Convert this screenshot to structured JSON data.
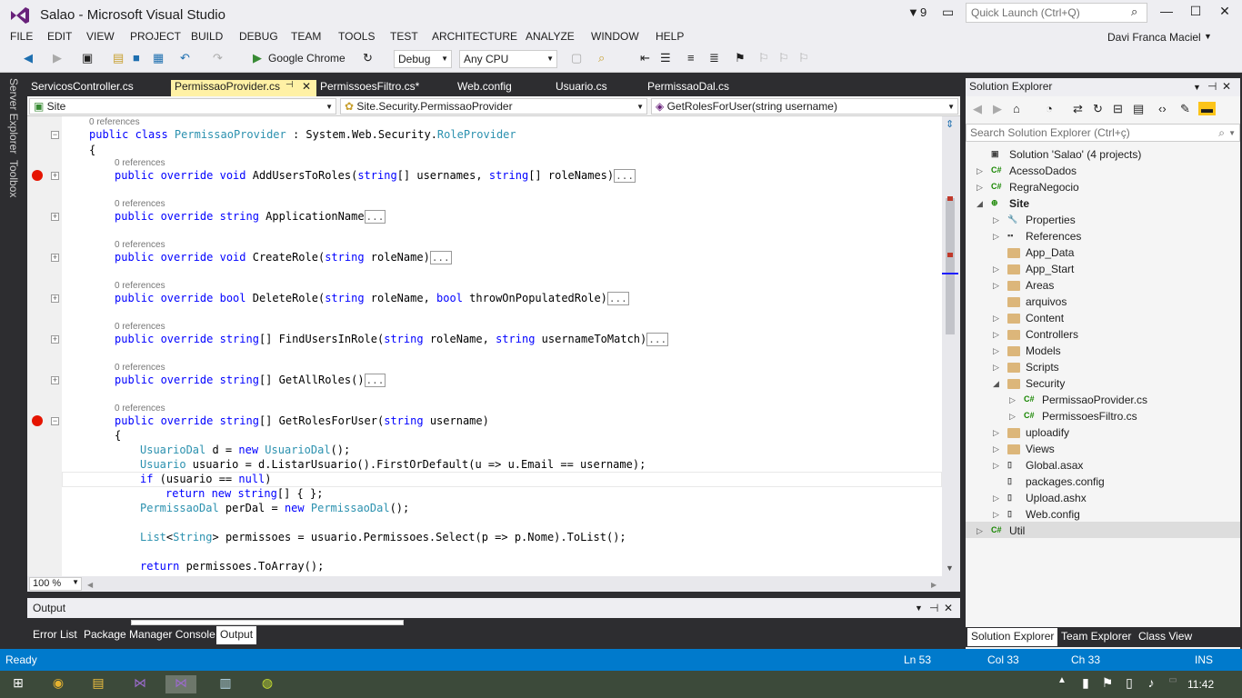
{
  "title": "Salao - Microsoft Visual Studio",
  "notifications": "9",
  "quick_launch": {
    "placeholder": "Quick Launch (Ctrl+Q)"
  },
  "menu": [
    "FILE",
    "EDIT",
    "VIEW",
    "PROJECT",
    "BUILD",
    "DEBUG",
    "TEAM",
    "TOOLS",
    "TEST",
    "ARCHITECTURE",
    "ANALYZE",
    "WINDOW",
    "HELP"
  ],
  "user": "Davi Franca Maciel",
  "toolbar": {
    "browser": "Google Chrome",
    "config": "Debug",
    "platform": "Any CPU"
  },
  "side_tabs": [
    "Server Explorer",
    "Toolbox"
  ],
  "tabs": [
    "ServicosController.cs",
    "PermissaoProvider.cs",
    "PermissoesFiltro.cs*",
    "Web.config",
    "Usuario.cs",
    "PermissaoDal.cs"
  ],
  "nav": {
    "project": "Site",
    "class": "Site.Security.PermissaoProvider",
    "member": "GetRolesForUser(string username)"
  },
  "code": {
    "refs": "0 references",
    "class_line": [
      "public class ",
      "PermissaoProvider",
      " : System.Web.Security.",
      "RoleProvider"
    ],
    "open_brace": "{",
    "methods": [
      {
        "pre": "public override ",
        "ret": "void",
        "name": " AddUsersToRoles(",
        "p1t": "string",
        "p1": "[] usernames, ",
        "p2t": "string",
        "p2": "[] roleNames)"
      },
      {
        "pre": "public override ",
        "ret": "string",
        "name": " ApplicationName",
        "p1t": "",
        "p1": "",
        "p2t": "",
        "p2": ""
      },
      {
        "pre": "public override ",
        "ret": "void",
        "name": " CreateRole(",
        "p1t": "string",
        "p1": " roleName)",
        "p2t": "",
        "p2": ""
      },
      {
        "pre": "public override ",
        "ret": "bool",
        "name": " DeleteRole(",
        "p1t": "string",
        "p1": " roleName, ",
        "p2t": "bool",
        "p2": " throwOnPopulatedRole)"
      },
      {
        "pre": "public override ",
        "ret": "string",
        "name": "[] FindUsersInRole(",
        "p1t": "string",
        "p1": " roleName, ",
        "p2t": "string",
        "p2": " usernameToMatch)"
      },
      {
        "pre": "public override ",
        "ret": "string",
        "name": "[] GetAllRoles()",
        "p1t": "",
        "p1": "",
        "p2t": "",
        "p2": ""
      }
    ],
    "collapsed": "...",
    "last_method": [
      "public override ",
      "string",
      "[] GetRolesForUser(",
      "string",
      " username)"
    ],
    "body_brace": "{",
    "body": {
      "l1": [
        "UsuarioDal",
        " d = ",
        "new",
        " ",
        "UsuarioDal",
        "();"
      ],
      "l2": [
        "Usuario",
        " usuario = d.ListarUsuario().FirstOrDefault(u => u.Email == username);"
      ],
      "l3": [
        "if",
        " (usuario == ",
        "null",
        ")"
      ],
      "l4": [
        "return new ",
        "string",
        "[] { };"
      ],
      "l5": [
        "PermissaoDal",
        " perDal = ",
        "new",
        " ",
        "PermissaoDal",
        "();"
      ],
      "l6": [
        "List",
        "<",
        "String",
        "> permissoes = usuario.Permissoes.Select(p => p.Nome).ToList();"
      ],
      "l7": [
        "return",
        " permissoes.ToArray();"
      ]
    }
  },
  "zoom": "100 %",
  "output": {
    "title": "Output",
    "tabs": [
      "Error List",
      "Package Manager Console",
      "Output"
    ]
  },
  "solution_explorer": {
    "title": "Solution Explorer",
    "search_placeholder": "Search Solution Explorer (Ctrl+ç)",
    "items": [
      "Solution 'Salao' (4 projects)",
      "AcessoDados",
      "RegraNegocio",
      "Site",
      "Properties",
      "References",
      "App_Data",
      "App_Start",
      "Areas",
      "arquivos",
      "Content",
      "Controllers",
      "Models",
      "Scripts",
      "Security",
      "PermissaoProvider.cs",
      "PermissoesFiltro.cs",
      "uploadify",
      "Views",
      "Global.asax",
      "packages.config",
      "Upload.ashx",
      "Web.config",
      "Util"
    ],
    "tabs": [
      "Solution Explorer",
      "Team Explorer",
      "Class View"
    ]
  },
  "status": {
    "ready": "Ready",
    "ln": "Ln 53",
    "col": "Col 33",
    "ch": "Ch 33",
    "mode": "INS"
  },
  "clock": "11:42"
}
